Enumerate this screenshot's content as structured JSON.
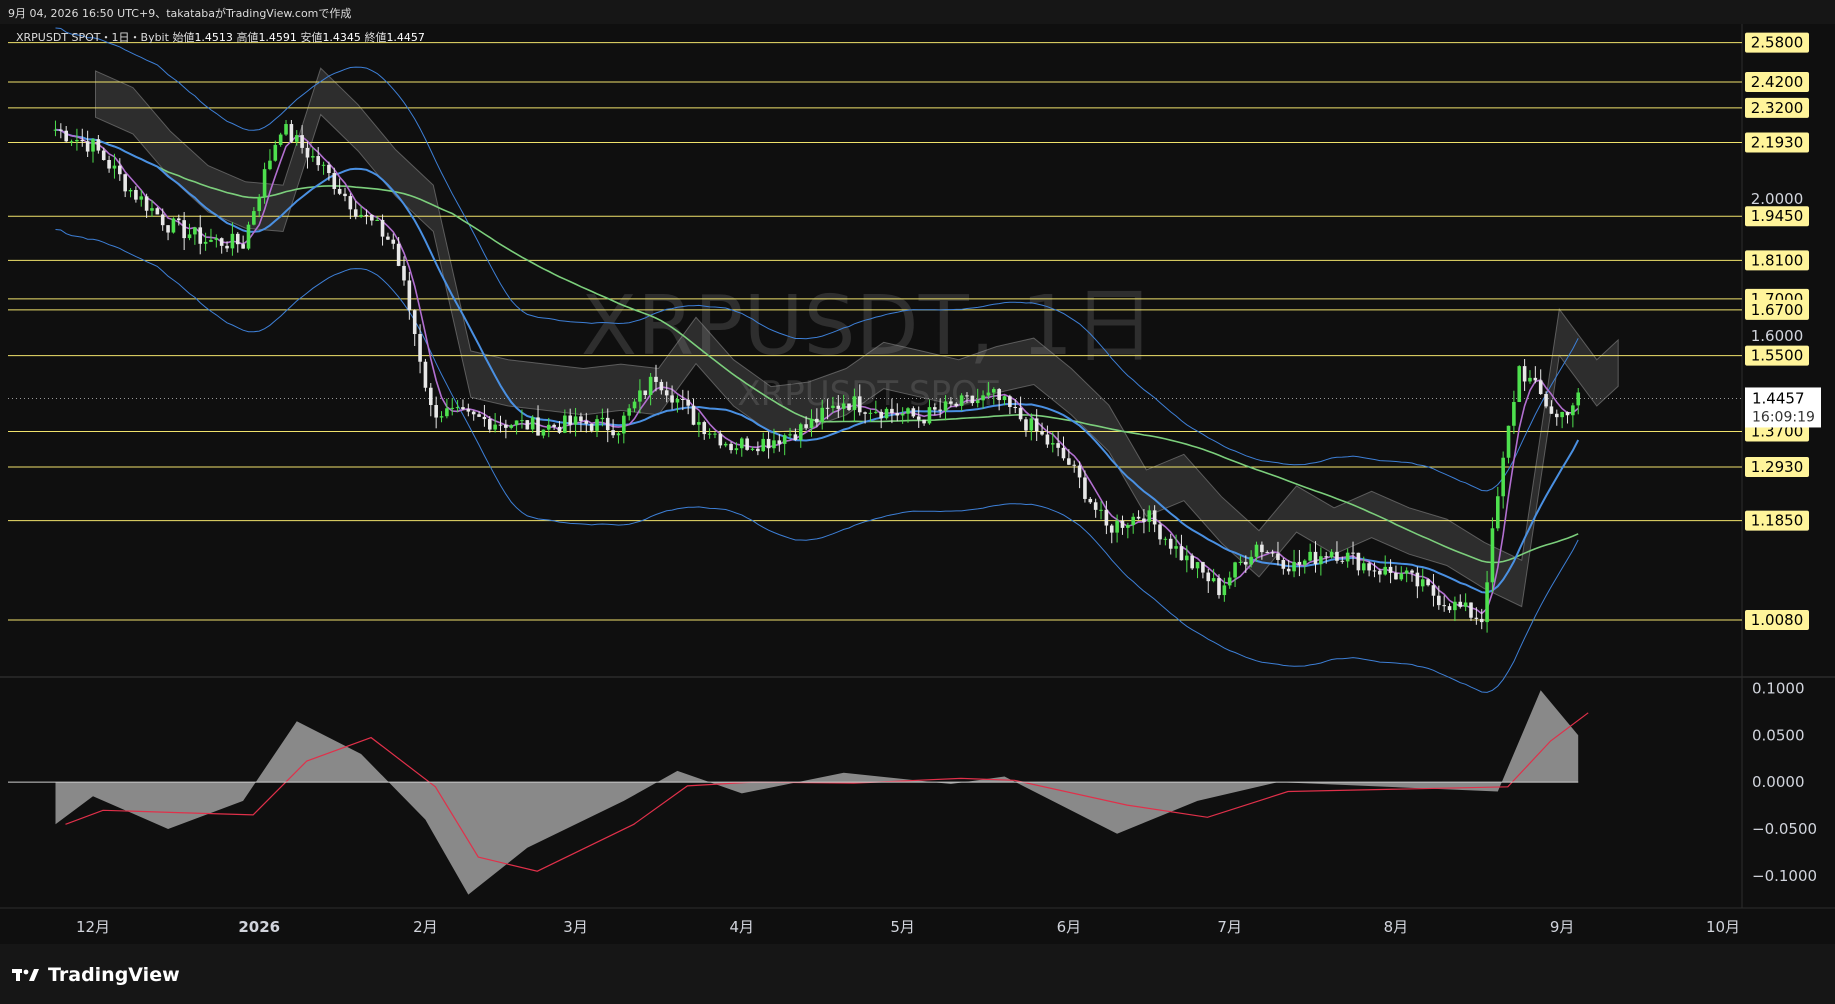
{
  "header": {
    "caption": "9月 04, 2026 16:50 UTC+9、takatabaがTradingView.comで作成"
  },
  "legend": {
    "symbol": "XRPUSDT SPOT・1日・Bybit",
    "open_label": "始値",
    "open": "1.4513",
    "high_label": "高値",
    "high": "1.4591",
    "low_label": "安値",
    "low": "1.4345",
    "close_label": "終値",
    "close": "1.4457"
  },
  "watermark": {
    "line1": "XRPUSDT, 1日",
    "line2": "XRPUSDT SPOT"
  },
  "footer": {
    "brand": "TradingView"
  },
  "colors": {
    "background": "#0f0f0f",
    "level_line": "#f0e26c",
    "level_label_bg": "#fff49a",
    "candle_up": "#4ee04e",
    "candle_down": "#e8e8e8",
    "bollinger": "#3d7fd6",
    "sma_fast": "#b26fd0",
    "sma_mid": "#4a90e2",
    "sma_slow": "#7ccf7c",
    "cloud": "#9a9a9a",
    "oscillator_fill": "#a8a8a8",
    "oscillator_signal": "#e0304a",
    "current_price_bg": "#ffffff"
  },
  "chart_data": {
    "type": "candlestick",
    "title": "XRPUSDT, 1日",
    "yscale": "log",
    "price_axis_ticks": [
      2.0,
      1.6
    ],
    "level_lines": [
      2.58,
      2.42,
      2.32,
      2.193,
      1.945,
      1.81,
      1.7,
      1.67,
      1.55,
      1.37,
      1.293,
      1.185,
      1.008
    ],
    "level_labels": [
      "2.5800",
      "2.4200",
      "2.3200",
      "2.1930",
      "1.9450",
      "1.8100",
      "1.7000",
      "1.6700",
      "1.5500",
      "1.3700",
      "1.2930",
      "1.1850",
      "1.0080"
    ],
    "plain_ticks": [
      "2.0000",
      "1.6000"
    ],
    "current_price": "1.4457",
    "countdown": "16:09:19",
    "x_ticks": [
      "12月",
      "2026",
      "2月",
      "3月",
      "4月",
      "5月",
      "6月",
      "7月",
      "8月",
      "9月",
      "10月"
    ],
    "approx_close_path": [
      [
        "2025-11-24",
        2.24
      ],
      [
        "2025-12-01",
        2.18
      ],
      [
        "2025-12-08",
        2.03
      ],
      [
        "2025-12-15",
        1.92
      ],
      [
        "2025-12-22",
        1.87
      ],
      [
        "2025-12-29",
        1.86
      ],
      [
        "2026-01-05",
        2.25
      ],
      [
        "2026-01-12",
        2.12
      ],
      [
        "2026-01-19",
        1.97
      ],
      [
        "2026-01-26",
        1.86
      ],
      [
        "2026-02-02",
        1.42
      ],
      [
        "2026-02-09",
        1.4
      ],
      [
        "2026-02-16",
        1.39
      ],
      [
        "2026-02-23",
        1.38
      ],
      [
        "2026-03-02",
        1.39
      ],
      [
        "2026-03-09",
        1.38
      ],
      [
        "2026-03-16",
        1.5
      ],
      [
        "2026-03-23",
        1.4
      ],
      [
        "2026-03-30",
        1.34
      ],
      [
        "2026-04-06",
        1.35
      ],
      [
        "2026-04-13",
        1.38
      ],
      [
        "2026-04-20",
        1.44
      ],
      [
        "2026-04-27",
        1.42
      ],
      [
        "2026-05-04",
        1.4
      ],
      [
        "2026-05-11",
        1.43
      ],
      [
        "2026-05-18",
        1.45
      ],
      [
        "2026-05-25",
        1.38
      ],
      [
        "2026-06-01",
        1.3
      ],
      [
        "2026-06-08",
        1.17
      ],
      [
        "2026-06-15",
        1.2
      ],
      [
        "2026-06-22",
        1.12
      ],
      [
        "2026-06-29",
        1.06
      ],
      [
        "2026-07-06",
        1.14
      ],
      [
        "2026-07-13",
        1.1
      ],
      [
        "2026-07-20",
        1.13
      ],
      [
        "2026-07-27",
        1.1
      ],
      [
        "2026-08-03",
        1.08
      ],
      [
        "2026-08-10",
        1.04
      ],
      [
        "2026-08-17",
        1.01
      ],
      [
        "2026-08-24",
        1.52
      ],
      [
        "2026-08-31",
        1.4
      ],
      [
        "2026-09-04",
        1.4457
      ]
    ],
    "oscillator": {
      "ticks": [
        "0.1000",
        "0.0500",
        "0.0000",
        "−0.0500",
        "−0.1000"
      ],
      "range": [
        -0.13,
        0.11
      ],
      "approx_values": [
        [
          "2025-11-24",
          -0.045
        ],
        [
          "2025-12-01",
          -0.015
        ],
        [
          "2025-12-15",
          -0.05
        ],
        [
          "2025-12-29",
          -0.02
        ],
        [
          "2026-01-08",
          0.065
        ],
        [
          "2026-01-20",
          0.03
        ],
        [
          "2026-02-01",
          -0.04
        ],
        [
          "2026-02-09",
          -0.12
        ],
        [
          "2026-02-20",
          -0.07
        ],
        [
          "2026-03-10",
          -0.02
        ],
        [
          "2026-03-20",
          0.012
        ],
        [
          "2026-04-01",
          -0.012
        ],
        [
          "2026-04-20",
          0.01
        ],
        [
          "2026-05-10",
          -0.002
        ],
        [
          "2026-05-20",
          0.006
        ],
        [
          "2026-06-10",
          -0.055
        ],
        [
          "2026-06-25",
          -0.02
        ],
        [
          "2026-07-10",
          0.0
        ],
        [
          "2026-08-20",
          -0.01
        ],
        [
          "2026-08-28",
          0.098
        ],
        [
          "2026-09-04",
          0.05
        ]
      ]
    }
  }
}
